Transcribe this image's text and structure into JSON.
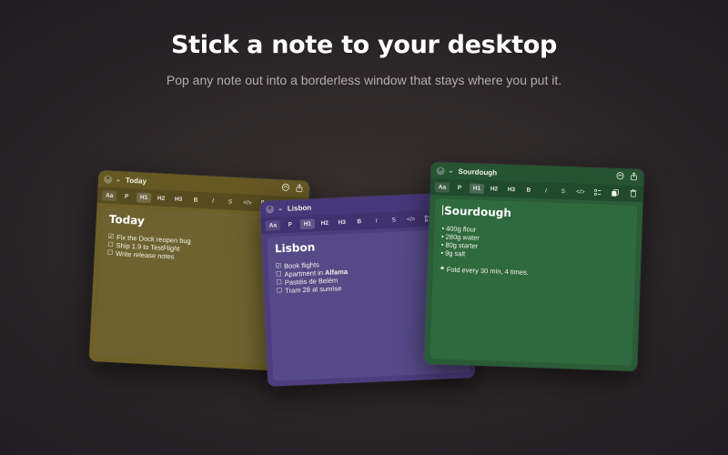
{
  "hero": {
    "title": "Stick a note to your desktop",
    "subtitle": "Pop any note out into a borderless window that stays where you put it."
  },
  "toolbar": {
    "aa": "Aa",
    "p": "P",
    "h1": "H1",
    "h2": "H2",
    "h3": "H3",
    "bold": "B",
    "italic": "I",
    "strike": "S",
    "code": "</>"
  },
  "notes": {
    "today": {
      "color": "#6d6028",
      "title": "Today",
      "heading": "Today",
      "items": [
        {
          "mark": "☑",
          "text": "Fix the Dock reopen bug"
        },
        {
          "mark": "☐",
          "text": "Ship 1.9 to TestFlight"
        },
        {
          "mark": "☐",
          "text": "Write release notes"
        }
      ]
    },
    "lisbon": {
      "color": "#4d3d7e",
      "title": "Lisbon",
      "heading": "Lisbon",
      "items": [
        {
          "mark": "☑",
          "text": "Book flights"
        },
        {
          "mark": "☐",
          "text": "Apartment in ",
          "bold": "Alfama"
        },
        {
          "mark": "☐",
          "text": "Pastéis de Belém"
        },
        {
          "mark": "☐",
          "text": "Tram 28 at sunrise"
        }
      ]
    },
    "sourdough": {
      "color": "#2a5c37",
      "title": "Sourdough",
      "heading": "Sourdough",
      "bullets": [
        "400g flour",
        "280g water",
        "80g starter",
        "9g salt"
      ],
      "quote": "Fold every 30 min, 4 times."
    }
  }
}
